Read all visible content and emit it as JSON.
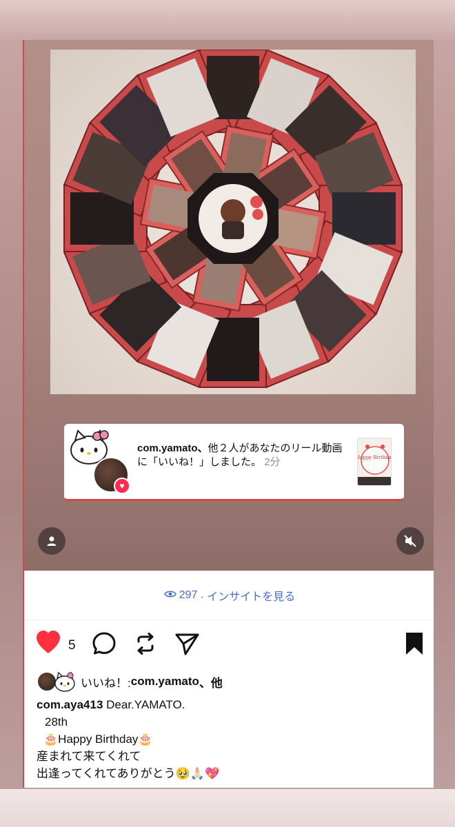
{
  "notification": {
    "username": "com.yamato、",
    "text": "他２人があなたのリール動画に「いいね！」しました。",
    "time": "2分"
  },
  "insights": {
    "views": "297",
    "label": "· インサイトを見る"
  },
  "actions": {
    "like_count": "5"
  },
  "likes_line": {
    "prefix": "いいね！: ",
    "user": "com.yamato",
    "suffix": "、他"
  },
  "caption": {
    "username": "com.aya413",
    "line1": "Dear.YAMATO.",
    "line2": "28th",
    "line3": "Happy Birthday",
    "line4": "産まれて来てくれて",
    "line5": "出逢ってくれてありがとう",
    "cake_emoji": "🎂",
    "end_emoji": "🥹🙏🏻💖"
  },
  "thumb_text": "Happy Birthday",
  "colors": {
    "like_red": "#ff3040",
    "link_blue": "#4a6ec7",
    "card_red": "#d04848"
  },
  "icons": [
    "user-icon",
    "mute-icon",
    "heart-icon",
    "comment-icon",
    "repost-icon",
    "send-icon",
    "bookmark-icon",
    "eye-icon"
  ]
}
